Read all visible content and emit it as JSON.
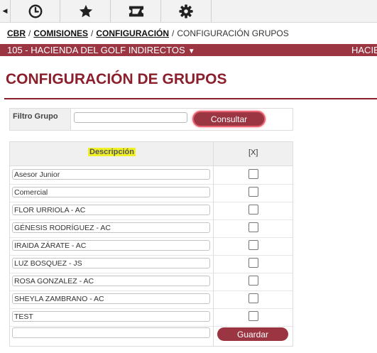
{
  "nav": {
    "buttons": [
      {
        "icon": "clock-icon"
      },
      {
        "icon": "star-icon"
      },
      {
        "icon": "ticket-icon"
      },
      {
        "icon": "gear-icon"
      }
    ]
  },
  "breadcrumb": {
    "items": [
      "CBR",
      "COMISIONES",
      "CONFIGURACIÓN"
    ],
    "current": "CONFIGURACIÓN GRUPOS",
    "separator": "/"
  },
  "company": {
    "name": "105 - HACIENDA DEL GOLF INDIRECTOS",
    "right_text": "HACIE"
  },
  "page": {
    "title": "CONFIGURACIÓN DE GRUPOS"
  },
  "filter": {
    "label": "Filtro Grupo",
    "value": "",
    "button": "Consultar"
  },
  "table": {
    "header_desc": "Descripción",
    "header_check": "[X]",
    "rows": [
      {
        "desc": "Asesor Junior",
        "checked": false
      },
      {
        "desc": "Comercial",
        "checked": false
      },
      {
        "desc": "FLOR URRIOLA - AC",
        "checked": false
      },
      {
        "desc": "GÉNESIS RODRÍGUEZ - AC",
        "checked": false
      },
      {
        "desc": "IRAIDA ZÁRATE - AC",
        "checked": false
      },
      {
        "desc": "LUZ BOSQUEZ - JS",
        "checked": false
      },
      {
        "desc": "ROSA GONZALEZ - AC",
        "checked": false
      },
      {
        "desc": "SHEYLA ZAMBRANO - AC",
        "checked": false
      },
      {
        "desc": "TEST",
        "checked": false
      }
    ],
    "new_value": "",
    "save_button": "Guardar"
  },
  "colors": {
    "brand": "#9b3541",
    "title": "#8c1f2c",
    "highlight": "#f0f028"
  }
}
